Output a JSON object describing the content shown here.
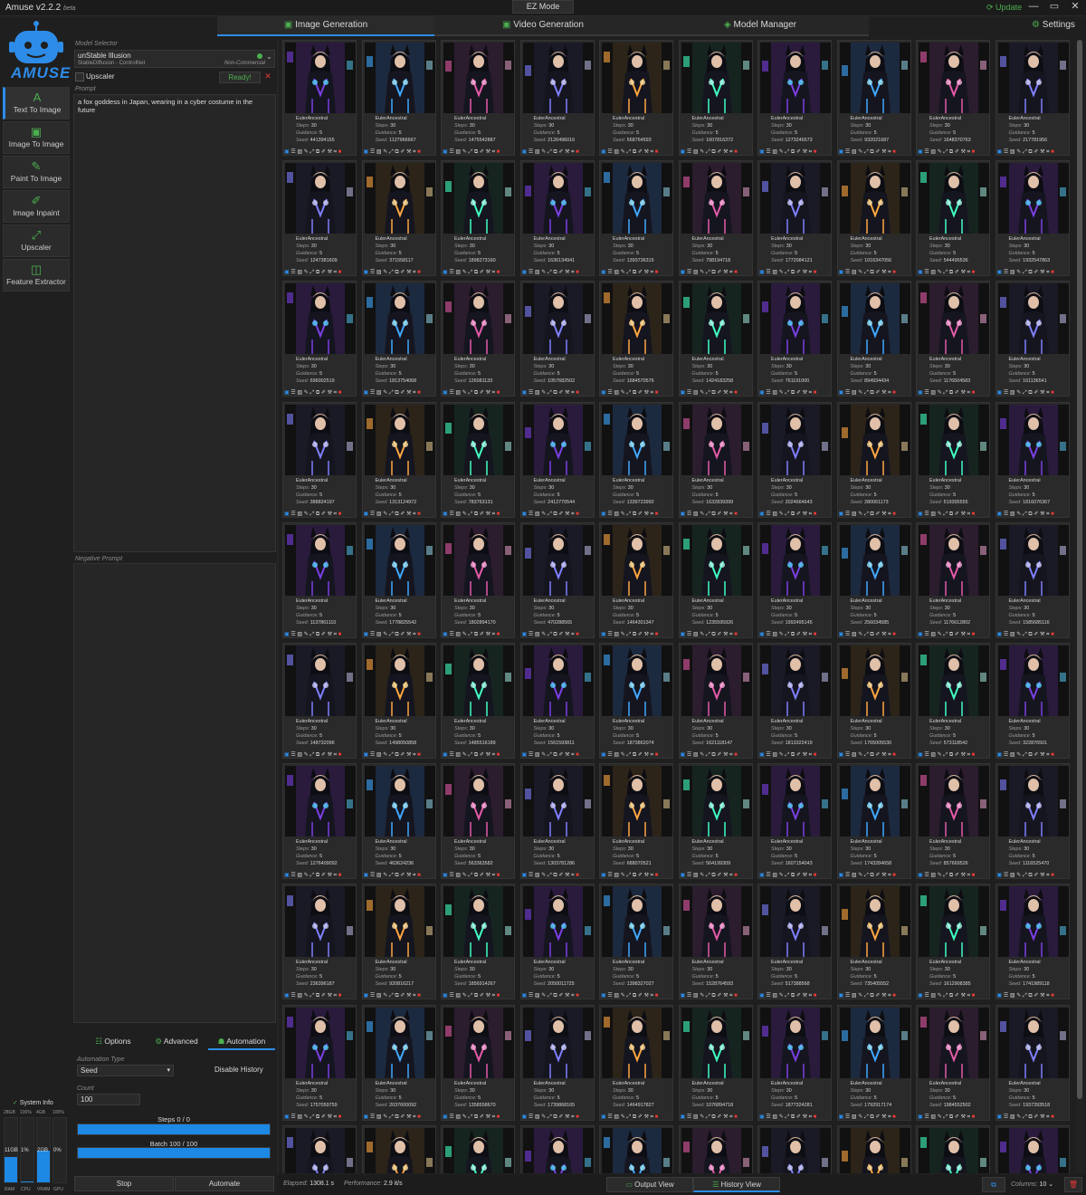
{
  "window": {
    "title": "Amuse v2.2.2",
    "title_suffix": "beta",
    "ez_mode": "EZ Mode",
    "update": "Update"
  },
  "tabs": [
    "Image Generation",
    "Video Generation",
    "Model Manager"
  ],
  "settings": "Settings",
  "logo_text": "AMUSE",
  "nav": [
    "Text To Image",
    "Image To Image",
    "Paint To Image",
    "Image Inpaint",
    "Upscaler",
    "Feature Extractor"
  ],
  "model": {
    "label": "Model Selector",
    "name": "unStable Illusion",
    "sub": "StableDiffusion - ControlNet",
    "license": "Non-Commercial",
    "upscaler": "Upscaler",
    "status": "Ready!",
    "close": "✕"
  },
  "prompt": {
    "label": "Prompt",
    "text": "a fox goddess in Japan, wearing in a cyber costume in the future"
  },
  "negative": {
    "label": "Negative Prompt",
    "text": ""
  },
  "subtabs": [
    "Options",
    "Advanced",
    "Automation"
  ],
  "automation": {
    "type_label": "Automation Type",
    "type_value": "Seed",
    "disable_history": "Disable History",
    "count_label": "Count",
    "count_value": "100",
    "steps_label": "Steps 0 / 0",
    "steps_progress": 0,
    "batch_label": "Batch 100 / 100",
    "batch_progress": 1.0,
    "stop": "Stop",
    "automate": "Automate"
  },
  "system": {
    "label": "System Info",
    "caps": [
      "28GB",
      "100%",
      "4GB",
      "100%"
    ],
    "values": [
      "11GB",
      "1%",
      "2GB",
      "0%"
    ],
    "names": [
      "RAM",
      "CPU",
      "VRAM",
      "GPU"
    ],
    "levels": [
      0.39,
      0.01,
      0.5,
      0
    ]
  },
  "cell_labels": {
    "scheduler": "EulerAncestral",
    "steps_k": "Steps:",
    "steps_v": "30",
    "guidance_k": "Guidance:",
    "guidance_v": "5",
    "seed_k": "Seed:"
  },
  "seeds": [
    [
      "441394155",
      "1127966667",
      "1475542887",
      "2126496016",
      "568764593",
      "1607816372",
      "1273246573",
      "932021687",
      "1648370763",
      "217781956"
    ],
    [
      "1247381609",
      "371558117",
      "1898273160",
      "1636134941",
      "1393736315",
      "798194718",
      "1772084121",
      "1016347056",
      "544495536",
      "1932547863"
    ],
    [
      "696002519",
      "1813754068",
      "126081133",
      "1057682502",
      "1684570576",
      "1424183258",
      "761191000",
      "894934434",
      "1176504583",
      "161136541"
    ],
    [
      "388824197",
      "1313124972",
      "783763131",
      "2412770544",
      "1339723992",
      "1632839399",
      "2024664643",
      "280061173",
      "519395555",
      "1816076367"
    ],
    [
      "1137861110",
      "1778825542",
      "1802894170",
      "470288565",
      "1464301347",
      "1235595926",
      "1992495145",
      "256034585",
      "1176612802",
      "1585685116"
    ],
    [
      "148732096",
      "1498050858",
      "1485516189",
      "1561593811",
      "1873862074",
      "1621118147",
      "1813322419",
      "1765005530",
      "573118542",
      "322876501"
    ],
    [
      "1276409092",
      "463624236",
      "563363582",
      "1303781286",
      "688070521",
      "564199309",
      "1607154043",
      "1743284658",
      "857669526",
      "1116525470"
    ],
    [
      "236396187",
      "920816217",
      "1856914267",
      "2050011725",
      "1398327027",
      "1528764593",
      "517388568",
      "735405552",
      "1612908385",
      "1741989118"
    ],
    [
      "1757059759",
      "2037600092",
      "1358558670",
      "1739868165",
      "1464917827",
      "1076894718",
      "1877324281",
      "1792917174",
      "1984552502",
      "1937393518"
    ],
    [
      "",
      "",
      "",
      "",
      "",
      "",
      "",
      "",
      "",
      ""
    ]
  ],
  "status": {
    "elapsed_k": "Elapsed:",
    "elapsed_v": "1308.1 s",
    "perf_k": "Performance:",
    "perf_v": "2.9 it/s",
    "output_view": "Output View",
    "history_view": "History View",
    "columns_k": "Columns:",
    "columns_v": "10"
  },
  "colors": {
    "accent": "#2d8ce8",
    "green": "#4caf50",
    "red": "#e53935"
  }
}
